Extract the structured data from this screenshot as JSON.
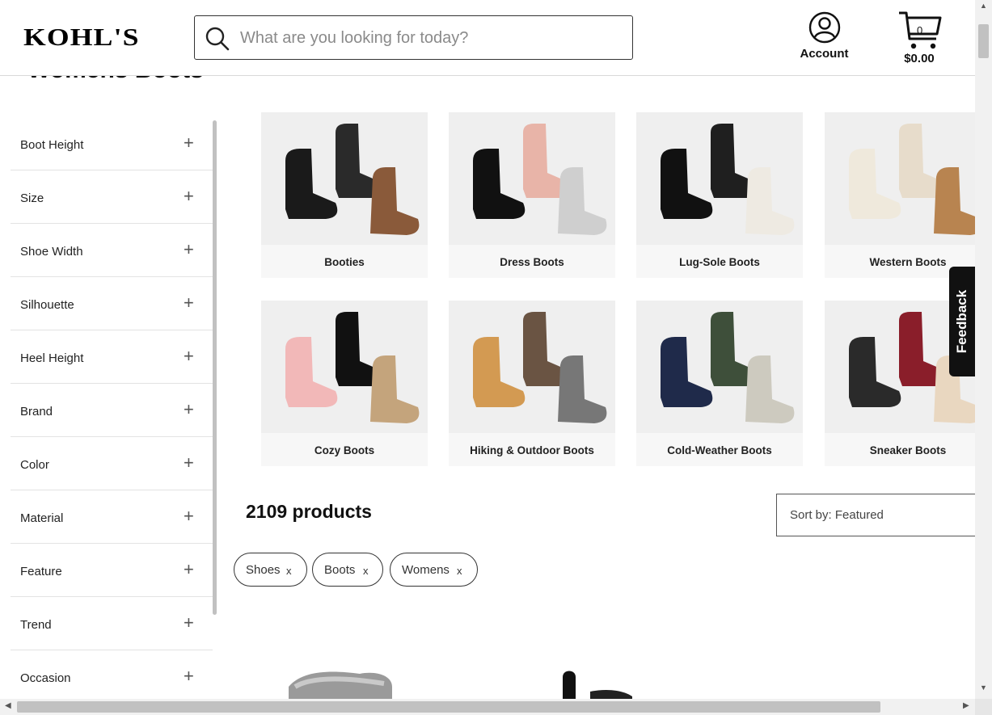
{
  "header": {
    "logo": "KOHL'S",
    "search_placeholder": "What are you looking for today?",
    "account_label": "Account",
    "cart_count": "0",
    "cart_total": "$0.00"
  },
  "page_title": "Womens Boots",
  "filters": [
    {
      "label": "Boot Height"
    },
    {
      "label": "Size"
    },
    {
      "label": "Shoe Width"
    },
    {
      "label": "Silhouette"
    },
    {
      "label": "Heel Height"
    },
    {
      "label": "Brand"
    },
    {
      "label": "Color"
    },
    {
      "label": "Material"
    },
    {
      "label": "Feature"
    },
    {
      "label": "Trend"
    },
    {
      "label": "Occasion"
    }
  ],
  "filter_expand_icon": "+",
  "categories": [
    {
      "label": "Booties",
      "image": "black ankle booties",
      "colors": [
        "#1a1a1a",
        "#2a2a2a",
        "#8a5a3a"
      ]
    },
    {
      "label": "Dress Boots",
      "image": "heeled dress boots",
      "colors": [
        "#111111",
        "#e8b4a8",
        "#cfcfcf"
      ]
    },
    {
      "label": "Lug-Sole Boots",
      "image": "tall lug-sole boots",
      "colors": [
        "#111111",
        "#1f1f1f",
        "#eeeae2"
      ]
    },
    {
      "label": "Western Boots",
      "image": "white western boots",
      "colors": [
        "#efe9dc",
        "#e7dccb",
        "#b88450"
      ]
    },
    {
      "label": "Cozy Boots",
      "image": "fur cozy boots",
      "colors": [
        "#f2b8b8",
        "#111111",
        "#c4a47c"
      ]
    },
    {
      "label": "Hiking & Outdoor Boots",
      "image": "hiking boots",
      "colors": [
        "#d39a52",
        "#6a5443",
        "#777777"
      ]
    },
    {
      "label": "Cold-Weather Boots",
      "image": "snow boots",
      "colors": [
        "#1f2a4a",
        "#3e4f3a",
        "#cdcabf"
      ]
    },
    {
      "label": "Sneaker Boots",
      "image": "sneaker boots",
      "colors": [
        "#2a2a2a",
        "#8a1e2a",
        "#e9d7c0"
      ]
    }
  ],
  "feedback_label": "Feedback",
  "product_count": "2109 products",
  "sort_label": "Sort by: Featured",
  "active_filters": [
    {
      "label": "Shoes",
      "remove": "x"
    },
    {
      "label": "Boots",
      "remove": "x"
    },
    {
      "label": "Womens",
      "remove": "x"
    }
  ]
}
